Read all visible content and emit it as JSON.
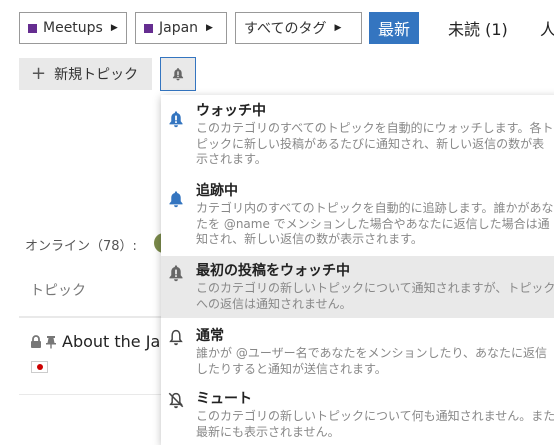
{
  "breadcrumbs": [
    {
      "label": "Meetups",
      "color": "#652d90"
    },
    {
      "label": "Japan",
      "color": "#652d90"
    },
    {
      "label": "すべてのタグ"
    }
  ],
  "nav": {
    "latest": "最新",
    "unread": "未読 (1)",
    "more": "人"
  },
  "new_topic_label": "新規トピック",
  "online_label": "オンライン（78）:",
  "topic_column_header": "トピック",
  "topic_row_title": "About the Ja",
  "notification_menu": [
    {
      "icon": "bell-exclamation-icon",
      "title": "ウォッチ中",
      "description": "このカテゴリのすべてのトピックを自動的にウォッチします。各トピックに新しい投稿があるたびに通知され、新しい返信の数が表示されます。"
    },
    {
      "icon": "bell-icon",
      "title": "追跡中",
      "description": "カテゴリ内のすべてのトピックを自動的に追跡します。誰かがあなたを @name でメンションした場合やあなたに返信した場合は通知され、新しい返信の数が表示されます。"
    },
    {
      "icon": "bell-exclamation-icon",
      "title": "最初の投稿をウォッチ中",
      "description": "このカテゴリの新しいトピックについて通知されますが、トピックへの返信は通知されません。",
      "selected": true
    },
    {
      "icon": "bell-outline-icon",
      "title": "通常",
      "description": "誰かが @ユーザー名であなたをメンションしたり、あなたに返信したりすると通知が送信されます。"
    },
    {
      "icon": "bell-slash-icon",
      "title": "ミュート",
      "description": "このカテゴリの新しいトピックについて何も通知されません。また最新にも表示されません。"
    }
  ],
  "colors": {
    "accent": "#3475c0",
    "category": "#652d90"
  }
}
